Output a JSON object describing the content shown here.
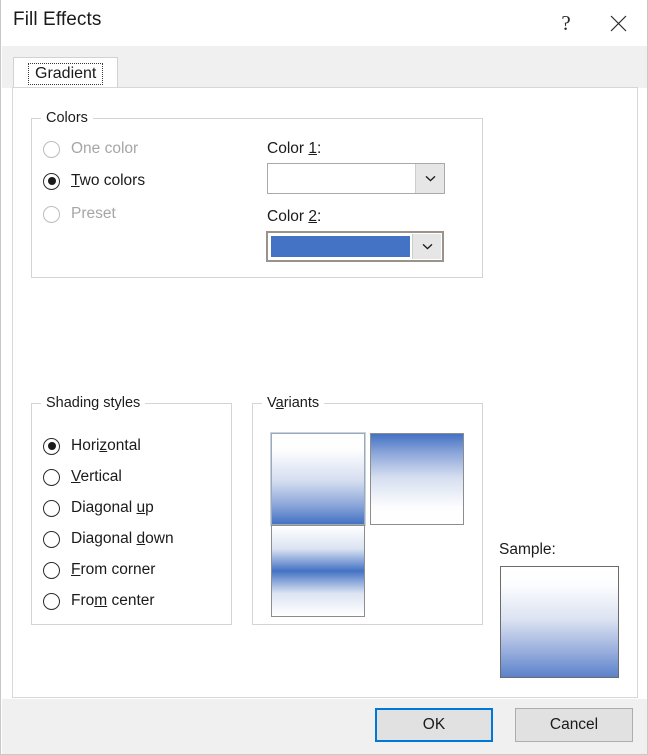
{
  "window": {
    "title": "Fill Effects",
    "help_button": "?",
    "close_button": "✕"
  },
  "tabs": [
    {
      "label": "Gradient",
      "selected": true
    }
  ],
  "colors_group": {
    "title": "Colors",
    "options": [
      {
        "label": "One color",
        "accel": "O",
        "checked": false,
        "disabled": true
      },
      {
        "label": "Two colors",
        "accel": "T",
        "checked": true,
        "disabled": false
      },
      {
        "label": "Preset",
        "accel": "P",
        "checked": false,
        "disabled": true
      }
    ],
    "color1": {
      "label": "Color 1:",
      "accel": "1",
      "value": "#FFFFFF",
      "focused": false,
      "dropdown_icon": "chevron-down-icon"
    },
    "color2": {
      "label": "Color 2:",
      "accel": "2",
      "value": "#4472C4",
      "focused": true,
      "dropdown_icon": "chevron-down-icon"
    }
  },
  "shading_group": {
    "title": "Shading styles",
    "options": [
      {
        "label": "Horizontal",
        "accel": "z",
        "checked": true
      },
      {
        "label": "Vertical",
        "accel": "V",
        "checked": false
      },
      {
        "label": "Diagonal up",
        "accel": "u",
        "checked": false
      },
      {
        "label": "Diagonal down",
        "accel": "d",
        "checked": false
      },
      {
        "label": "From corner",
        "accel": "F",
        "checked": false
      },
      {
        "label": "From center",
        "accel": "m",
        "checked": false
      }
    ]
  },
  "variants_group": {
    "title": "Variants",
    "accel": "a",
    "items": [
      {
        "name": "variant-white-to-blue-down",
        "gradient": "linear-gradient(to bottom, #FFFFFF 0%, #FDFDFE 18%, #D5DEF0 52%, #8FA8DA 78%, #4472C4 100%)",
        "selected": true
      },
      {
        "name": "variant-blue-to-white-down",
        "gradient": "linear-gradient(to bottom, #4472C4 0%, #8FA8DA 22%, #D5DEF0 48%, #FDFDFE 82%, #FFFFFF 100%)",
        "selected": false
      },
      {
        "name": "variant-white-blue-white",
        "gradient": "linear-gradient(to bottom, #FFFFFF 0%, #DCE4F2 25%, #4472C4 50%, #DCE4F2 75%, #FFFFFF 100%)",
        "selected": false
      }
    ]
  },
  "sample": {
    "label": "Sample:",
    "gradient": "linear-gradient(to bottom, #FFFFFF 0%, #FCFDFE 16%, #DBE2F1 48%, #9AAFDD 76%, #5B82CA 100%)"
  },
  "footer": {
    "ok_label": "OK",
    "cancel_label": "Cancel"
  },
  "theme": {
    "accent_blue": "#4472C4",
    "focus_blue": "#0078D7",
    "dialog_gray": "#F0F0F0"
  }
}
